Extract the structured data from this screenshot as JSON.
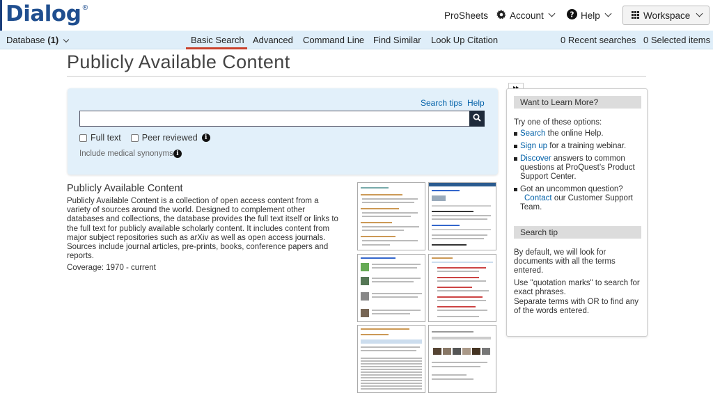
{
  "header": {
    "logo": "Dialog",
    "logo_mark": "®",
    "proscheets": "ProSheets",
    "account": "Account",
    "help": "Help",
    "workspace": "Workspace"
  },
  "subnav": {
    "database": "Database",
    "database_count": "(1)",
    "tabs": [
      "Basic Search",
      "Advanced",
      "Command Line",
      "Find Similar",
      "Look Up Citation"
    ],
    "recent": "0 Recent searches",
    "selected": "0 Selected items"
  },
  "page": {
    "title": "Publicly Available Content"
  },
  "search": {
    "tips": "Search tips",
    "help": "Help",
    "value": "",
    "full_text": "Full text",
    "peer_reviewed": "Peer reviewed",
    "medical_synonyms": "Include medical synonyms"
  },
  "content": {
    "title": "Publicly Available Content",
    "description": "Publicly Available Content is a collection of open access content from a variety of sources around the world.  Designed to complement other databases and collections, the database provides the full text itself or links to the full text for publicly available scholarly content. It includes content from major subject repositories such as arXiv as well as open access journals. Sources include journal articles, pre-prints, books, conference papers and reports.",
    "coverage": "Coverage: 1970 - current"
  },
  "sidebar": {
    "collapse": "▸▸",
    "learn_header": "Want to Learn More?",
    "intro": "Try one of these options:",
    "items": [
      {
        "link": "Search",
        "text": " the online Help."
      },
      {
        "link": "Sign up",
        "text": " for a training webinar."
      },
      {
        "link": "Discover",
        "text": " answers to common questions at ProQuest’s Product Support Center."
      },
      {
        "pre": "Got an uncommon question? ",
        "link": "Contact",
        "text": " our Customer Support Team."
      }
    ],
    "tip_header": "Search tip",
    "tip1": "By default, we will look for documents with all the terms entered.",
    "tip2": "Use \"quotation marks\" to search for exact phrases.",
    "tip3": "Separate terms with OR to find any of the words entered."
  },
  "colors": {
    "accent": "#0060a8",
    "active_tab": "#c8412c",
    "subbar": "#dfeef9",
    "search_bg": "#e2f0fa"
  }
}
